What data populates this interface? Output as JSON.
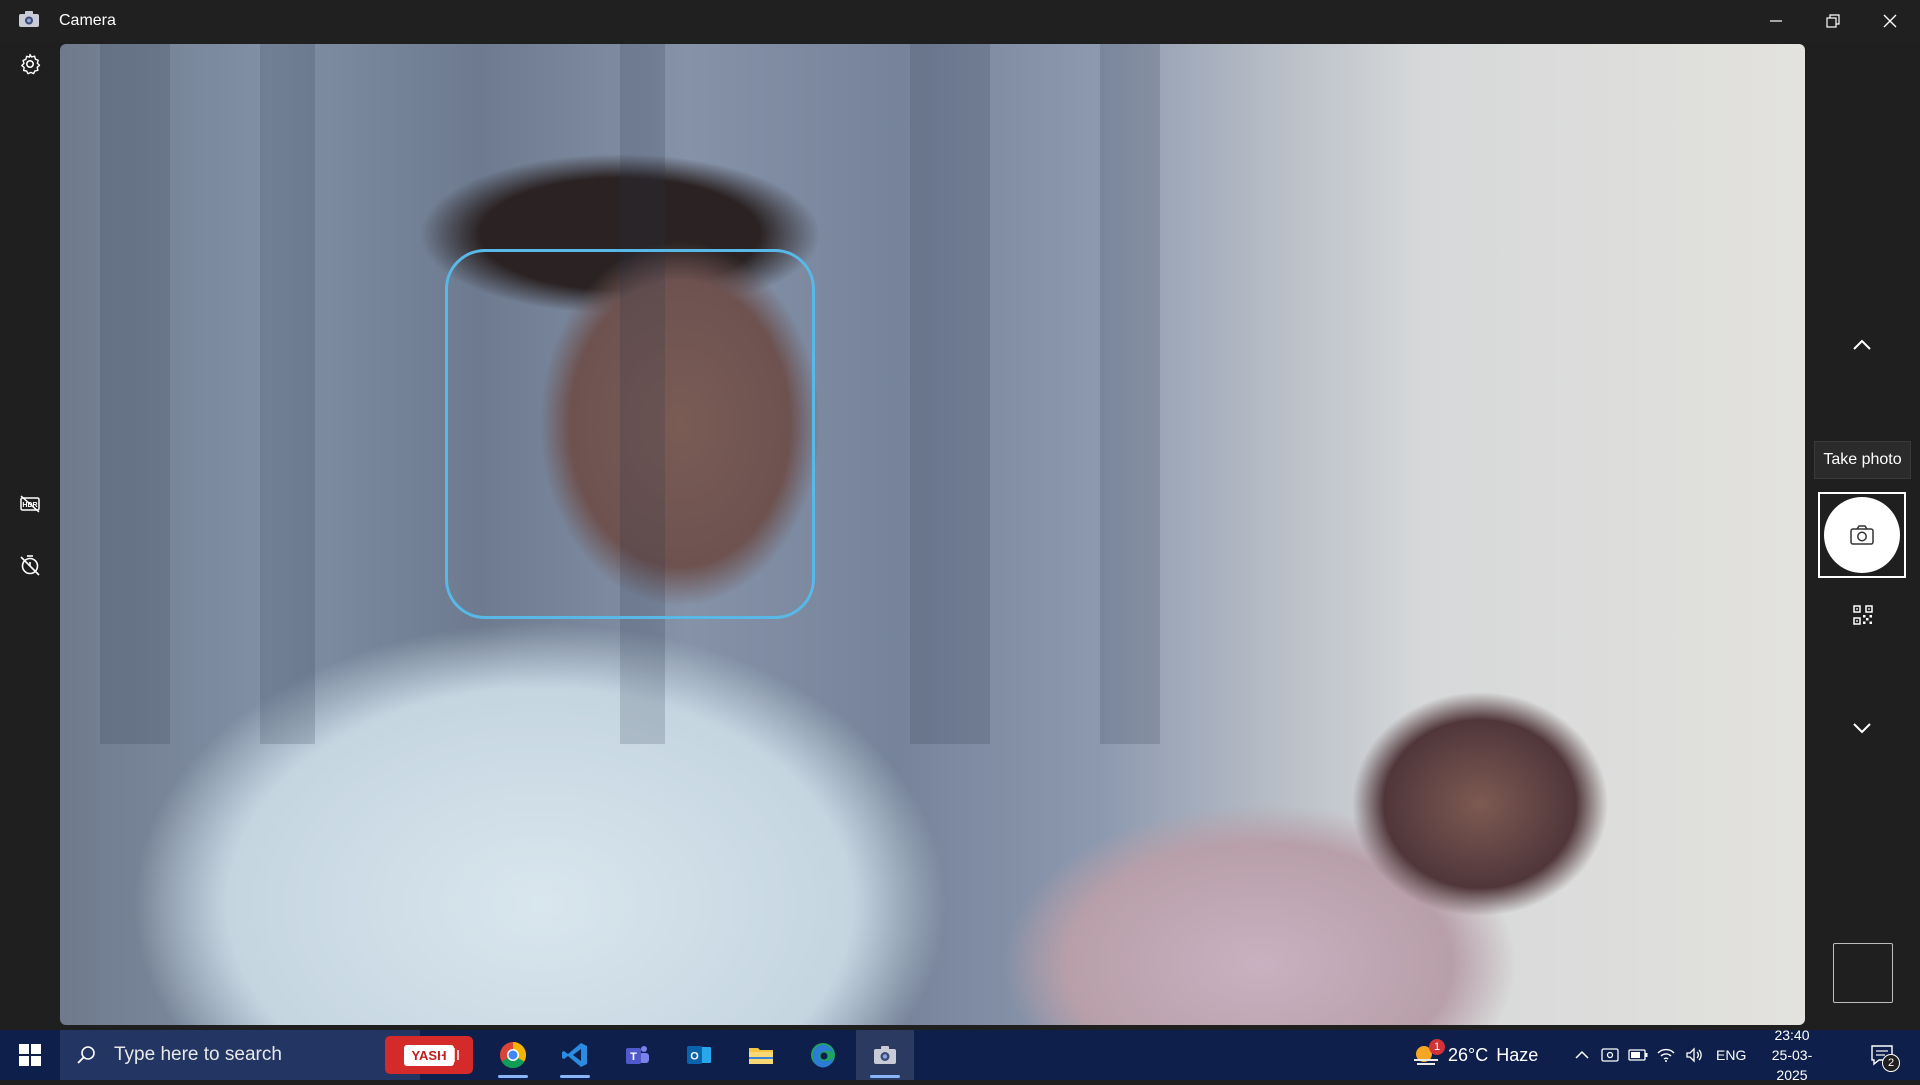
{
  "window": {
    "title": "Camera",
    "controls": [
      "minimize",
      "restore",
      "close"
    ]
  },
  "left_rail": {
    "settings_icon": "gear-icon",
    "hdr_icon": "hdr-off-icon",
    "timer_icon": "timer-off-icon"
  },
  "right_rail": {
    "up_icon": "chevron-up-icon",
    "tooltip": "Take photo",
    "shutter_icon": "camera-icon",
    "qr_icon": "qr-scan-icon",
    "down_icon": "chevron-down-icon"
  },
  "taskbar": {
    "search_placeholder": "Type here to search",
    "search_ad_label": "YASH",
    "pinned": [
      "chrome",
      "vscode",
      "teams",
      "outlook",
      "file-explorer",
      "edge",
      "camera"
    ],
    "weather": {
      "temp": "26°C",
      "condition": "Haze",
      "badge": "1"
    },
    "language": "ENG",
    "time": "23:40",
    "date": "25-03-2025",
    "notifications": "2"
  },
  "colors": {
    "face_box": "#58b8e8",
    "taskbar": "#0d1f4a",
    "titlebar": "#202020"
  }
}
